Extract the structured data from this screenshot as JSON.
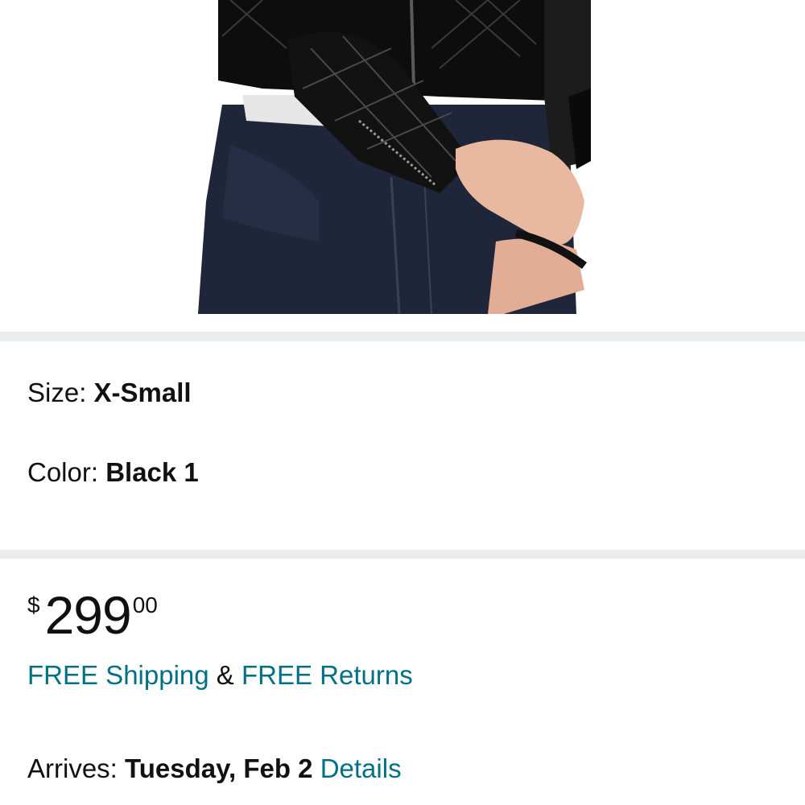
{
  "product_image": {
    "icon": "product-photo-leather-jacket"
  },
  "variations": {
    "size_label": "Size: ",
    "size_value": "X-Small",
    "color_label": "Color: ",
    "color_value": "Black 1"
  },
  "price": {
    "symbol": "$",
    "whole": "299",
    "fraction": "00"
  },
  "shipping": {
    "free_shipping": "FREE Shipping",
    "ampersand": " & ",
    "free_returns": "FREE Returns"
  },
  "delivery": {
    "label": "Arrives: ",
    "date": "Tuesday, Feb 2",
    "details_link": "Details"
  },
  "colors": {
    "link": "#007185",
    "separator": "#eaeded",
    "text": "#111111"
  }
}
